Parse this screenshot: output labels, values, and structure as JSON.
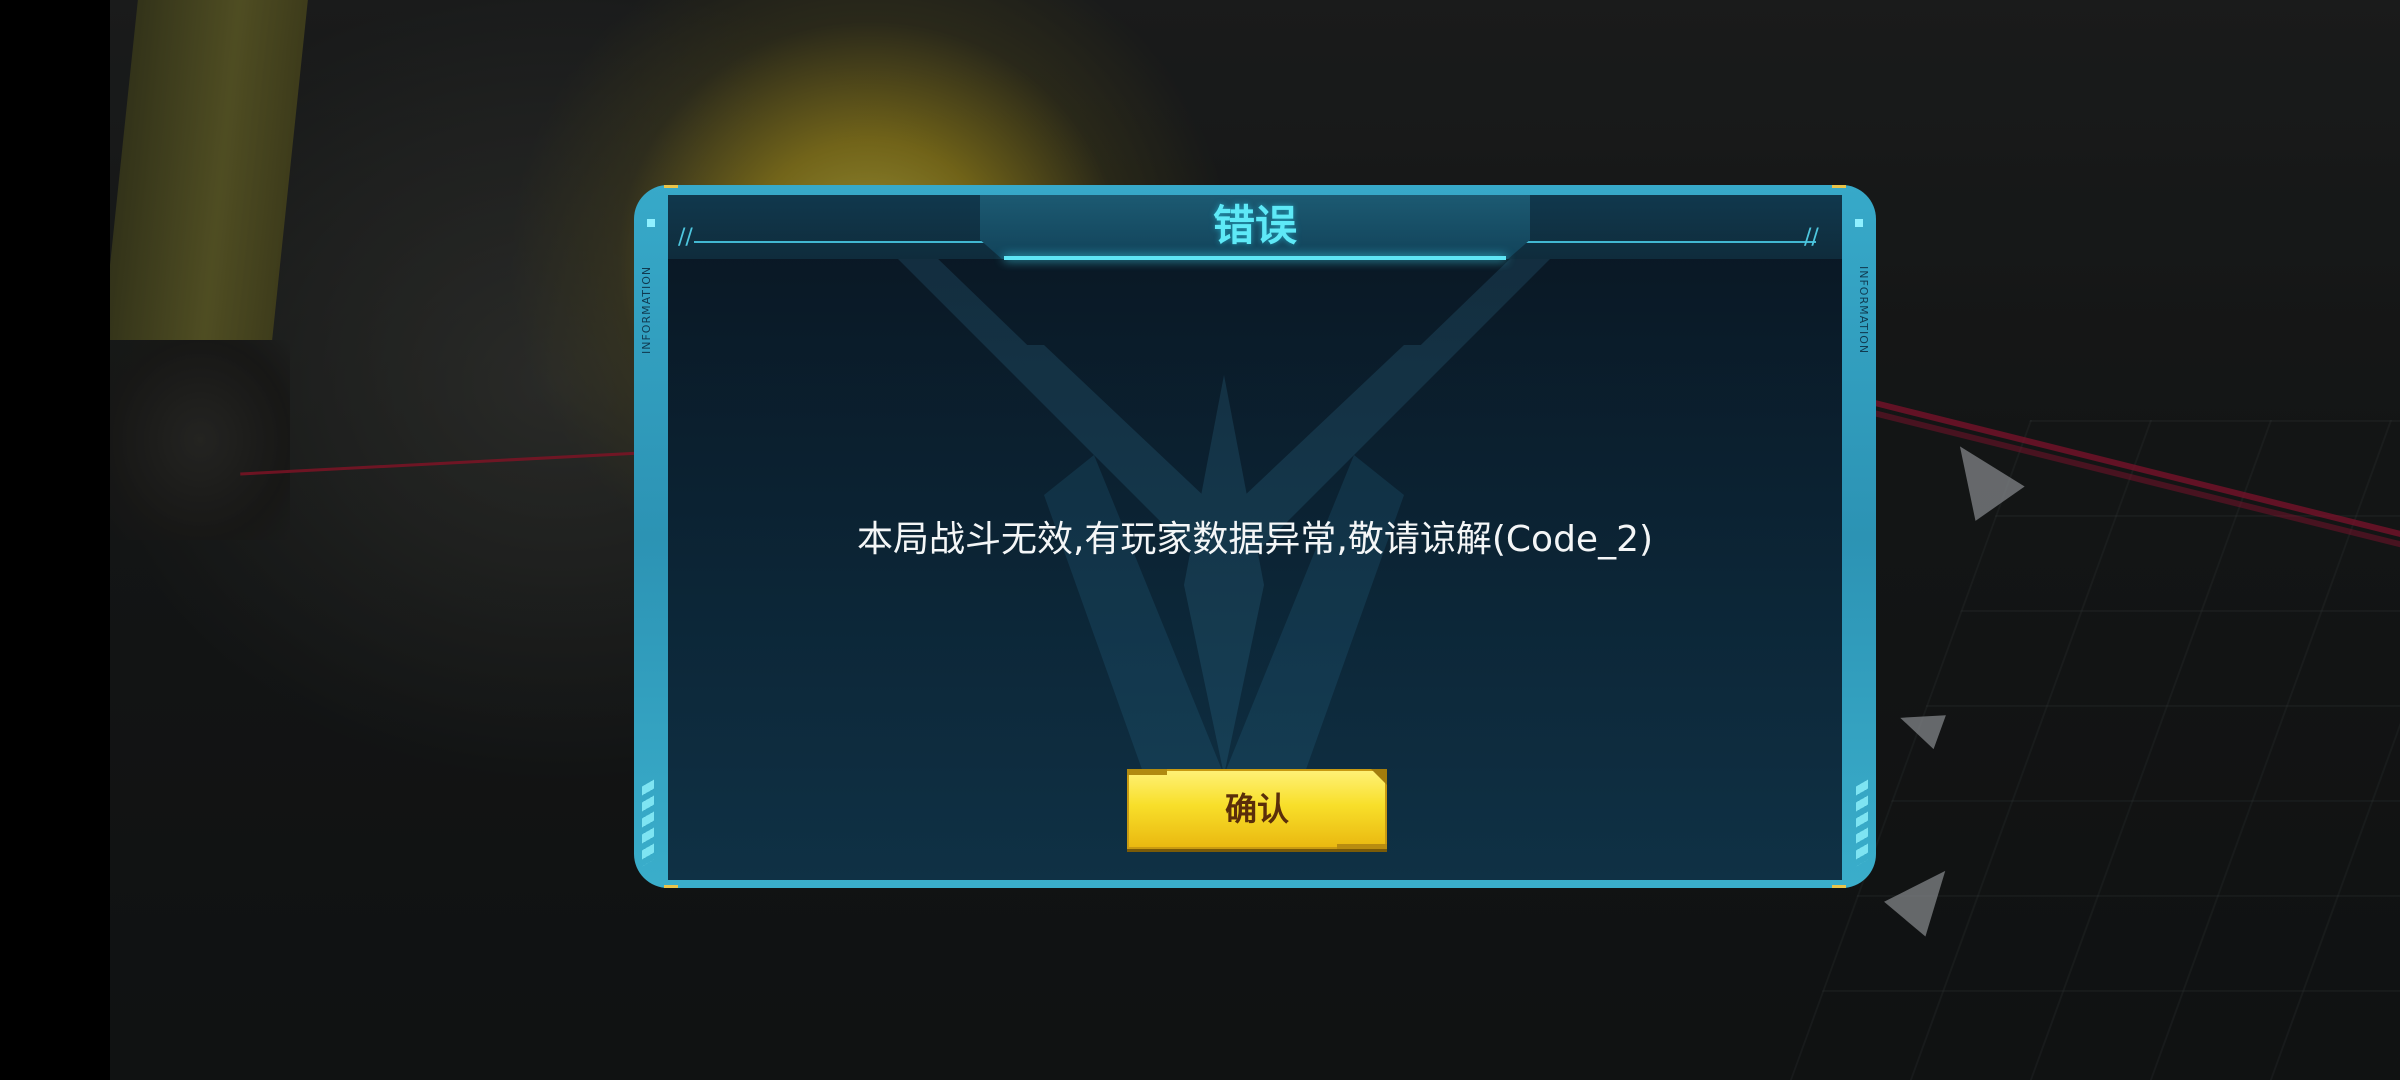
{
  "dialog": {
    "title": "错误",
    "message": "本局战斗无效,有玩家数据异常,敬请谅解(Code_2)",
    "confirm_label": "确认",
    "side_label": "INFORMATION"
  },
  "colors": {
    "frame": "#2c93b4",
    "title": "#5ee9f7",
    "panel": "#0b2232",
    "button": "#f8df2a",
    "button_text": "#5a2e0a"
  },
  "icons": [
    "emblem-icon",
    "ship-icon"
  ]
}
